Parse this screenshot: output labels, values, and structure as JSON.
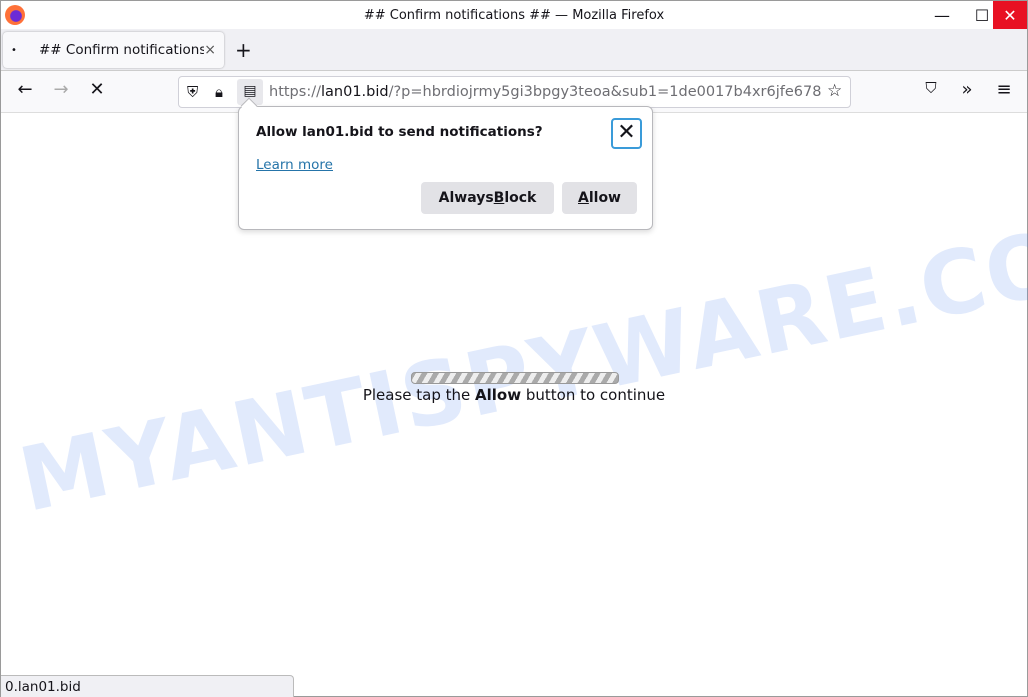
{
  "window": {
    "title": "## Confirm notifications ## — Mozilla Firefox",
    "minimize": "—",
    "maximize": "☐",
    "close": "✕",
    "close_color": "#e81123"
  },
  "tab": {
    "indicator": "•",
    "title": "## Confirm notifications",
    "close": "×",
    "new_tab": "+"
  },
  "nav": {
    "back": "←",
    "forward": "→",
    "stop": "✕",
    "url_scheme": "https://",
    "url_host": "lan01.bid",
    "url_rest": "/?p=hbrdiojrmy5gi3bpgy3teoa&sub1=1de0017b4xr6jfe678",
    "bookmark": "☆",
    "pocket": "⛉",
    "overflow": "»",
    "menu": "≡"
  },
  "popup": {
    "title": "Allow lan01.bid to send notifications?",
    "close": "✕",
    "learn_more": "Learn more",
    "block_pre": "Always ",
    "block_key": "B",
    "block_post": "lock",
    "allow_key": "A",
    "allow_post": "llow"
  },
  "page": {
    "msg_pre": "Please tap the ",
    "msg_bold": "Allow",
    "msg_post": " button to continue"
  },
  "watermark": "MYANTISPYWARE.COM",
  "status": "0.lan01.bid"
}
